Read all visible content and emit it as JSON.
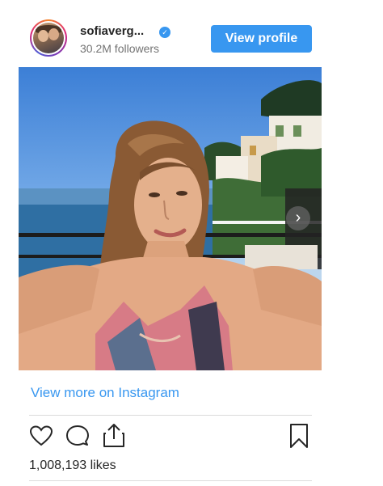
{
  "header": {
    "username": "sofiaverg...",
    "followers": "30.2M followers",
    "view_profile_label": "View profile",
    "verified_glyph": "✓"
  },
  "post": {
    "carousel_next_glyph": "›",
    "view_more_label": "View more on Instagram",
    "likes": "1,008,193 likes"
  },
  "colors": {
    "accent": "#3897f0",
    "text": "#262626",
    "muted": "#737373",
    "divider": "#dbdbdb"
  },
  "icons": {
    "avatar": "profile-avatar",
    "verified": "verified-badge-icon",
    "like": "heart-icon",
    "comment": "comment-bubble-icon",
    "share": "share-upload-icon",
    "save": "bookmark-icon",
    "next": "chevron-right-icon"
  }
}
